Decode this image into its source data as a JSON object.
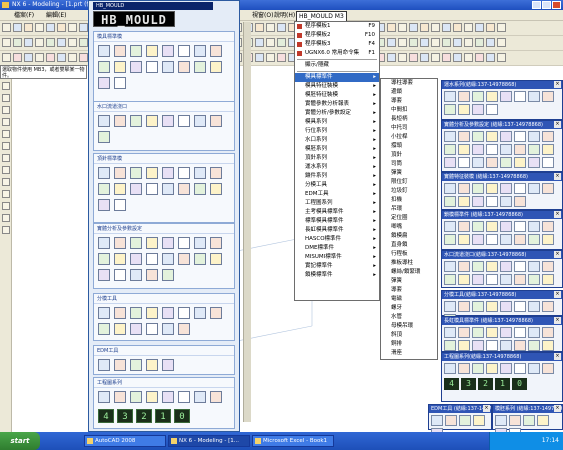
{
  "window": {
    "title": "NX 6 - Modeling - [1.prt (修改的)]"
  },
  "menubar": {
    "left_items": [
      "檔案(F)",
      "編輯(E)"
    ],
    "right_items": [
      "視窗(O)",
      "說明(H)"
    ],
    "active_item": "HB_MOULD M3"
  },
  "banner": {
    "text": "選取物件使用 MB3，或者雙擊某一物件。"
  },
  "palette": {
    "title": "HB_MOULD",
    "logo": "HB_MOULD",
    "sections": [
      {
        "title": "模具標準模"
      },
      {
        "title": "水口流道浇口"
      },
      {
        "title": "頂針標準模"
      },
      {
        "title": "實體分析及參數設定"
      },
      {
        "title": "分模工具"
      },
      {
        "title": "EDM工具"
      },
      {
        "title": "工程圖系列"
      }
    ],
    "number_buttons": [
      "4",
      "3",
      "2",
      "1",
      "0"
    ]
  },
  "main_menu": {
    "items": [
      {
        "label": "程序模板1",
        "key": "F9"
      },
      {
        "label": "程序模板2",
        "key": "F10"
      },
      {
        "label": "程序模板3",
        "key": "F4"
      },
      {
        "label": "UGNX6.0 常用命令集",
        "key": "F1"
      },
      {
        "label": "顯示/隱藏"
      },
      {
        "label": "模具標準件"
      },
      {
        "label": "模具特征裝模"
      },
      {
        "label": "模胚特征裝模"
      },
      {
        "label": "實體參數分析報表"
      },
      {
        "label": "實體分析/參數設定"
      },
      {
        "label": "模具系列"
      },
      {
        "label": "行位系列"
      },
      {
        "label": "水口系列"
      },
      {
        "label": "模胚系列"
      },
      {
        "label": "頂針系列"
      },
      {
        "label": "運水系列"
      },
      {
        "label": "鑲件系列"
      },
      {
        "label": "分模工具"
      },
      {
        "label": "EDM工具"
      },
      {
        "label": "工程圖系列"
      },
      {
        "label": "主考模具標準件"
      },
      {
        "label": "標準模具標準件"
      },
      {
        "label": "長虹模具標準件"
      },
      {
        "label": "HASCO標準件"
      },
      {
        "label": "DME標準件"
      },
      {
        "label": "MISUMI標準件"
      },
      {
        "label": "實記標準件"
      },
      {
        "label": "鎖模標準件"
      }
    ]
  },
  "submenu": {
    "items": [
      "導柱導套",
      "邊鎖",
      "導套",
      "中間扣",
      "長短柄",
      "中托司",
      "小拉桿",
      "撐頭",
      "頂針",
      "司筒",
      "彈簧",
      "限位釘",
      "垃圾釘",
      "扣機",
      "吊環",
      "定位圈",
      "唧嘴",
      "鎖模扁",
      "直身鎖",
      "行程板",
      "推板導柱",
      "螺絲/鎖緊環",
      "彈簧",
      "導套",
      "電磁",
      "螺牙",
      "水管",
      "母模吊環",
      "斜頂",
      "銅排",
      "滑座"
    ]
  },
  "right_panels": [
    {
      "title": "運水系列(結緣:137-14978868)"
    },
    {
      "title": "實體分析及參數設定 (結緣:137-14978868)"
    },
    {
      "title": "實體特征裝模 (結緣:137-14978868)"
    },
    {
      "title": "鎖模標準件 (結緣:137-14978868)"
    },
    {
      "title": "水口流道浇口(結緣:137-14978868)"
    },
    {
      "title": "分模工具(結緣:137-14978868)"
    },
    {
      "title": "長虹模具標準件 (結緣:137-14978868)"
    },
    {
      "title": "工程圖系列(結緣:137-14978868)"
    },
    {
      "title": "EDM工具 (結緣:137-14978868)"
    },
    {
      "title": "模胚系列 (結緣:137-14978868)"
    }
  ],
  "taskbar": {
    "start_label": "start",
    "tasks": [
      "AutoCAD 2008",
      "NX 6 - Modeling - [1...",
      "Microsoft Excel - Book1"
    ],
    "clock": "17:14"
  }
}
